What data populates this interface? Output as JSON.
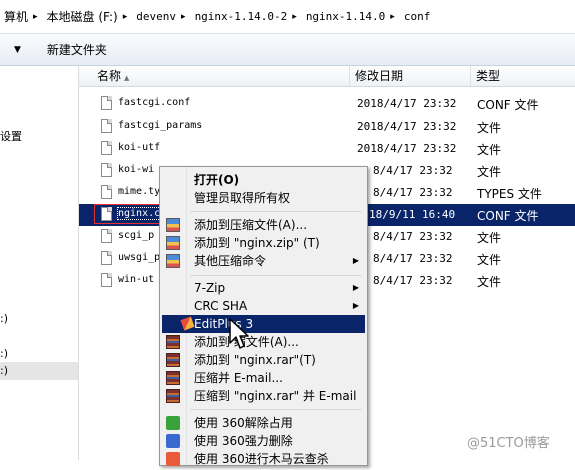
{
  "address": {
    "segments": [
      "算机",
      "本地磁盘 (F:)",
      "devenv",
      "nginx-1.14.0-2",
      "nginx-1.14.0",
      "conf"
    ]
  },
  "toolbar": {
    "new_folder_label": "新建文件夹"
  },
  "nav": {
    "items": [
      "",
      "设置",
      ":)",
      ":)",
      ":)"
    ]
  },
  "columns": {
    "name": "名称",
    "date": "修改日期",
    "type": "类型"
  },
  "files": [
    {
      "name": "fastcgi.conf",
      "date": "2018/4/17 23:32",
      "type": "CONF 文件"
    },
    {
      "name": "fastcgi_params",
      "date": "2018/4/17 23:32",
      "type": "文件"
    },
    {
      "name": "koi-utf",
      "date": "2018/4/17 23:32",
      "type": "文件"
    },
    {
      "name": "koi-wi",
      "date": "8/4/17 23:32",
      "type": "文件"
    },
    {
      "name": "mime.ty",
      "date": "8/4/17 23:32",
      "type": "TYPES 文件"
    },
    {
      "name": "nginx.c",
      "date": "18/9/11 16:40",
      "type": "CONF 文件",
      "selected": true
    },
    {
      "name": "scgi_p",
      "date": "8/4/17 23:32",
      "type": "文件"
    },
    {
      "name": "uwsgi_p",
      "date": "8/4/17 23:32",
      "type": "文件"
    },
    {
      "name": "win-ut",
      "date": "8/4/17 23:32",
      "type": "文件"
    }
  ],
  "context_menu": {
    "items": [
      {
        "label": "打开(O)",
        "bold": true,
        "icon": ""
      },
      {
        "label": "管理员取得所有权",
        "icon": ""
      },
      {
        "label": "添加到压缩文件(A)...",
        "icon": "zip-icon"
      },
      {
        "label": "添加到 \"nginx.zip\" (T)",
        "icon": "zip-icon"
      },
      {
        "label": "其他压缩命令",
        "icon": "zip-icon",
        "submenu": true
      },
      {
        "label": "7-Zip",
        "icon": "",
        "submenu": true
      },
      {
        "label": "CRC SHA",
        "icon": "",
        "submenu": true
      },
      {
        "label": "EditPlus 3",
        "icon": "editplus-icon",
        "highlighted": true
      },
      {
        "label": "添加到 缩文件(A)...",
        "icon": "winrar-icon"
      },
      {
        "label": "添加到 \"nginx.rar\"(T)",
        "icon": "winrar-icon"
      },
      {
        "label": "压缩并 E-mail...",
        "icon": "winrar-icon"
      },
      {
        "label": "压缩到 \"nginx.rar\" 并 E-mail",
        "icon": "winrar-icon"
      },
      {
        "label": "使用 360解除占用",
        "icon": "360-icon"
      },
      {
        "label": "使用 360强力删除",
        "icon": "360-icon"
      },
      {
        "label": "使用 360进行木马云查杀",
        "icon": "360-icon"
      }
    ]
  },
  "watermark": "@51CTO博客",
  "colors": {
    "selection": "#0a246a",
    "menu_bg": "#f0f0f0",
    "annotation_box": "#e03030"
  }
}
